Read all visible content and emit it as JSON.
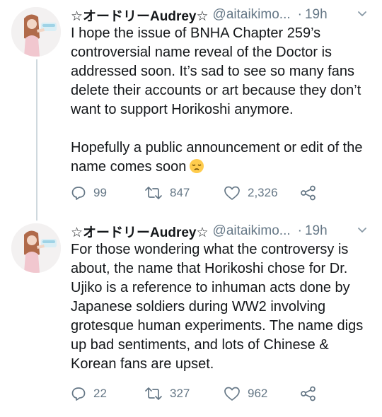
{
  "colors": {
    "text": "#14171a",
    "secondary": "#657786",
    "thread_line": "#cfd9de"
  },
  "tweets": [
    {
      "display_name": "☆オードリーAudrey☆",
      "handle": "@aitaikimo...",
      "separator": "·",
      "time": "19h",
      "text": "I hope the issue of BNHA Chapter 259’s controversial name reveal of the Doctor is addressed soon. It’s sad to see so many fans delete their accounts or art because they don’t want to support Horikoshi anymore.\n\nHopefully a public announcement or edit of the name comes soon",
      "emoji": "pensive-face-emoji",
      "replies": "99",
      "retweets": "847",
      "likes": "2,326"
    },
    {
      "display_name": "☆オードリーAudrey☆",
      "handle": "@aitaikimo...",
      "separator": "·",
      "time": "19h",
      "text": "For those wondering what the controversy is about, the name that Horikoshi chose for Dr. Ujiko is a reference to inhuman acts done by Japanese soldiers during WW2 involving grotesque human experiments. The name digs up bad sentiments, and lots of Chinese & Korean fans are upset.",
      "replies": "22",
      "retweets": "327",
      "likes": "962"
    }
  ]
}
